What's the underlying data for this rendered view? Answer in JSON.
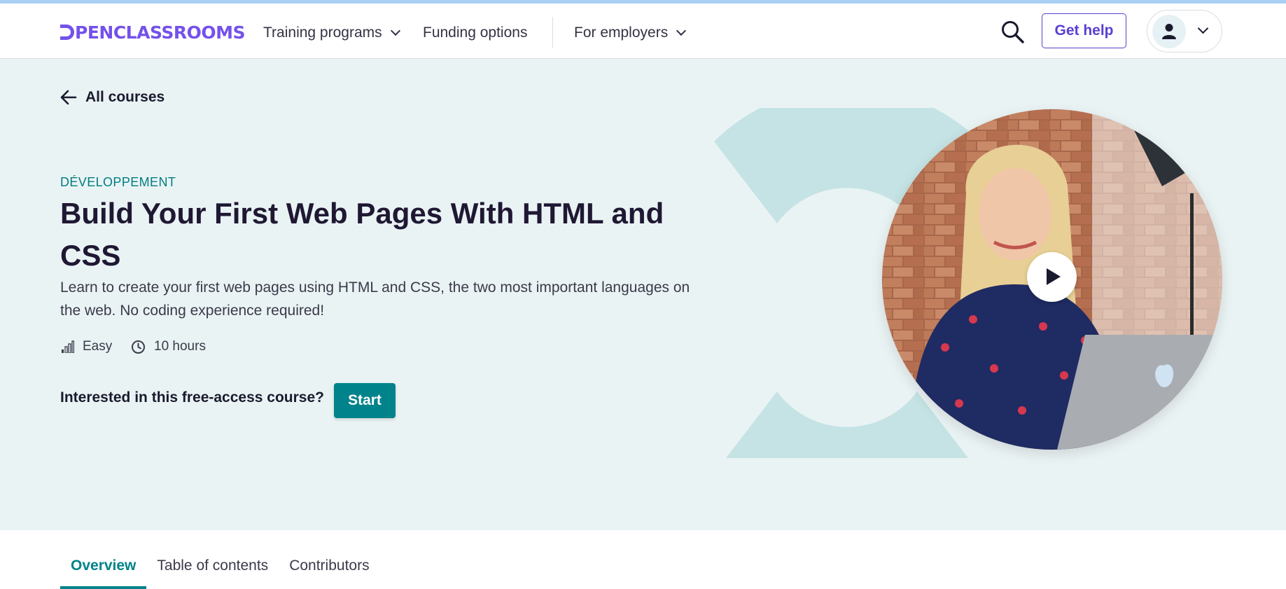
{
  "header": {
    "logo_text": "PENCLASSROOMS",
    "nav": [
      {
        "label": "Training programs",
        "has_dropdown": true
      },
      {
        "label": "Funding options",
        "has_dropdown": false
      },
      {
        "label": "For employers",
        "has_dropdown": true
      }
    ],
    "search_icon": "search-icon",
    "get_help_label": "Get help",
    "account_icon": "user-icon",
    "brand_color": "#7451eb"
  },
  "hero": {
    "back_label": "All courses",
    "category": "DÉVELOPPEMENT",
    "title": "Build Your First Web Pages With HTML and CSS",
    "description": "Learn to create your first web pages using HTML and CSS, the two most important languages on the web. No coding experience required!",
    "difficulty": "Easy",
    "duration": "10 hours",
    "cta_text": "Interested in this free-access course?",
    "start_label": "Start",
    "accent_color": "#00838a",
    "background_color": "#eaf3f4"
  },
  "tabs": [
    {
      "label": "Overview",
      "active": true
    },
    {
      "label": "Table of contents",
      "active": false
    },
    {
      "label": "Contributors",
      "active": false
    }
  ]
}
